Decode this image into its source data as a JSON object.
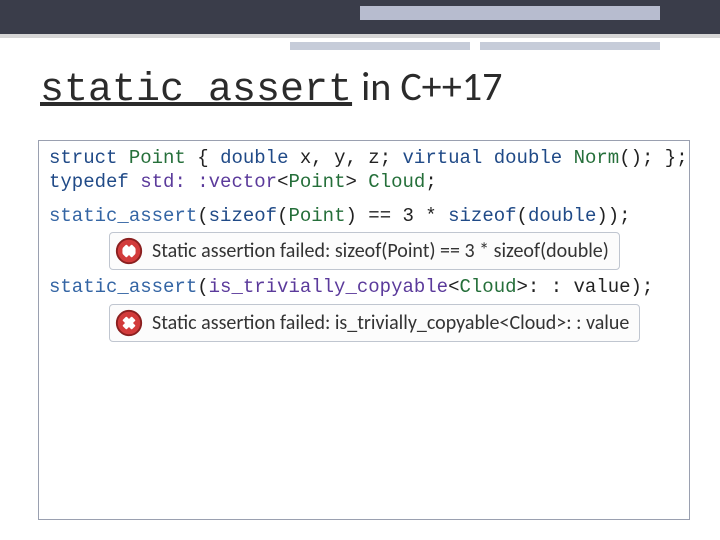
{
  "title": {
    "keyword": "static_assert",
    "rest": " in C++17"
  },
  "code": {
    "l1": {
      "a": "struct",
      "b": "Point",
      "c": "{",
      "d": "double",
      "e": "x, y, z;",
      "f": "virtual",
      "g": "double",
      "h": "Norm",
      "i": "(); };"
    },
    "l2": {
      "a": "typedef",
      "b": "std: :vector",
      "c": "<",
      "d": "Point",
      "e": ">",
      "f": "Cloud",
      "g": ";"
    },
    "l3": {
      "a": "static_assert",
      "b": "(",
      "c": "sizeof",
      "d": "(",
      "e": "Point",
      "f": ") == 3 * ",
      "g": "sizeof",
      "h": "(",
      "i": "double",
      "j": "));"
    },
    "l4": {
      "a": "static_assert",
      "b": "(",
      "c": "is_trivially_copyable",
      "d": "<",
      "e": "Cloud",
      "f": ">: : value);"
    }
  },
  "errors": [
    "Static assertion failed: sizeof(Point) == 3 * sizeof(double)",
    "Static assertion failed: is_trivially_copyable<Cloud>: : value"
  ]
}
